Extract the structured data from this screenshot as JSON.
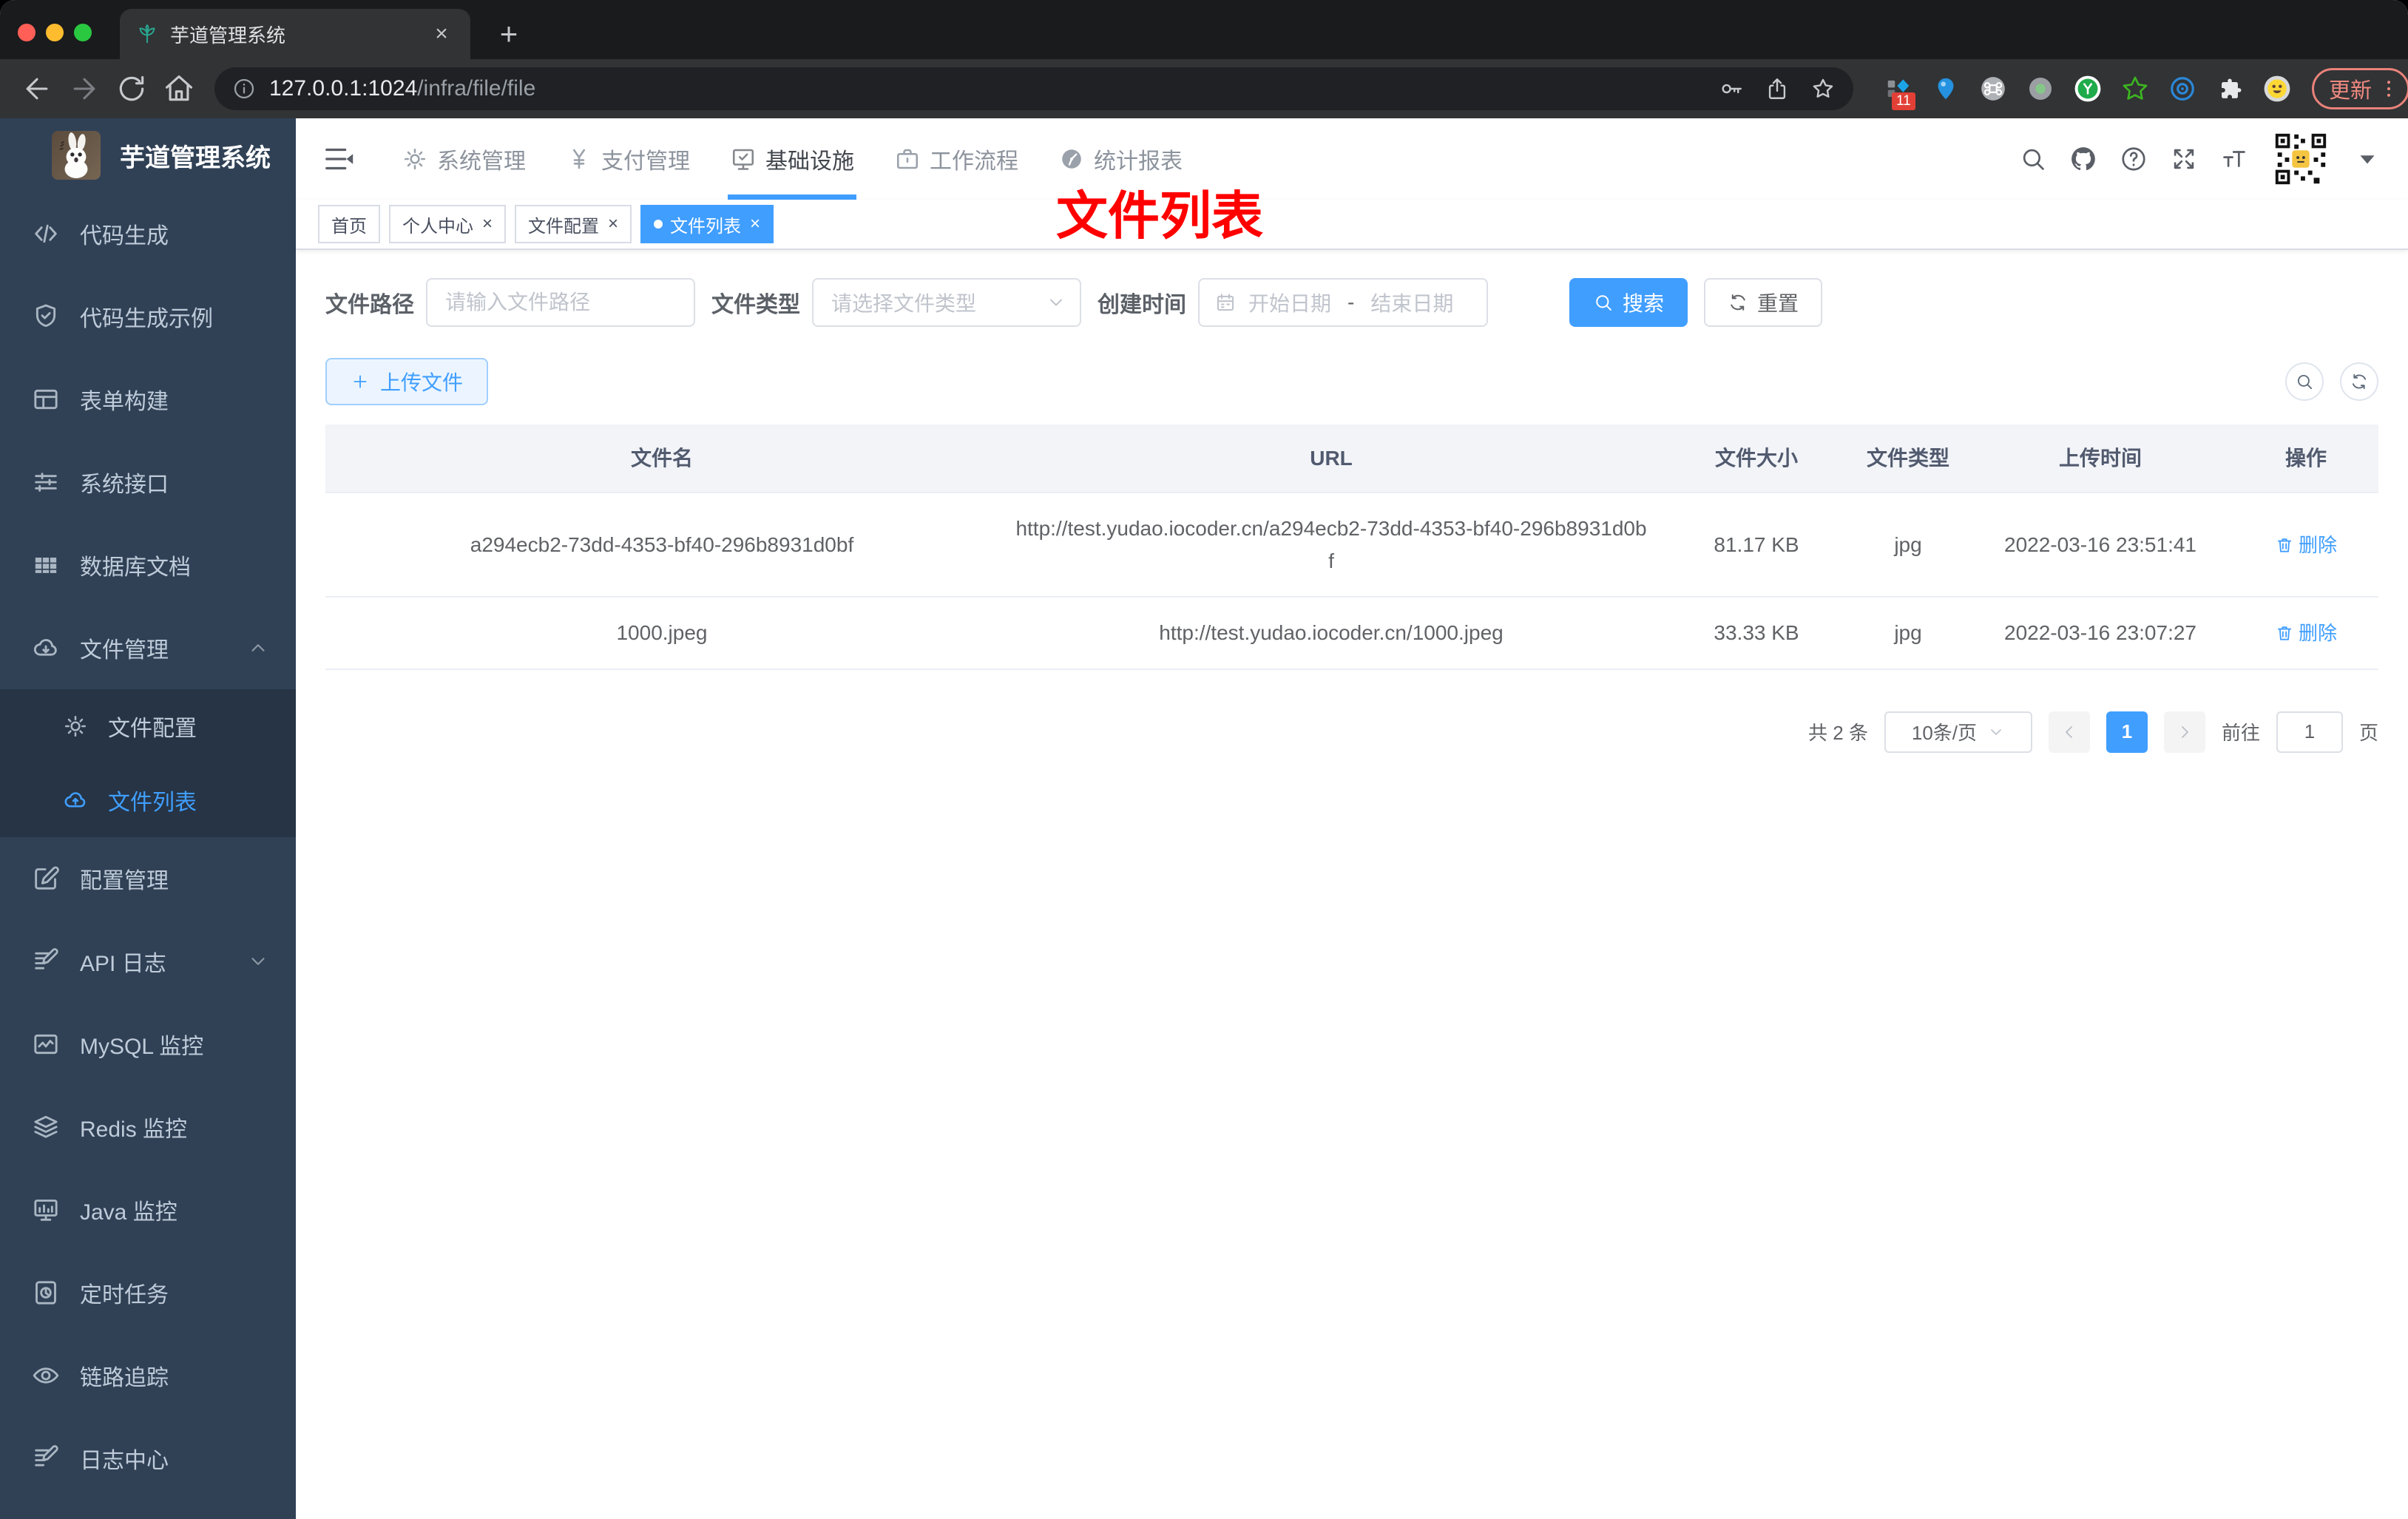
{
  "browser": {
    "tab_title": "芋道管理系统",
    "url_host": "127.0.0.1:1024",
    "url_path": "/infra/file/file",
    "extension_badge": "11",
    "update_label": "更新"
  },
  "glyphs": {
    "plus": "+",
    "close": "×"
  },
  "sidebar": {
    "title": "芋道管理系统",
    "items": [
      {
        "label": "代码生成"
      },
      {
        "label": "代码生成示例"
      },
      {
        "label": "表单构建"
      },
      {
        "label": "系统接口"
      },
      {
        "label": "数据库文档"
      },
      {
        "label": "文件管理"
      },
      {
        "label": "配置管理"
      },
      {
        "label": "API 日志"
      },
      {
        "label": "MySQL 监控"
      },
      {
        "label": "Redis 监控"
      },
      {
        "label": "Java 监控"
      },
      {
        "label": "定时任务"
      },
      {
        "label": "链路追踪"
      },
      {
        "label": "日志中心"
      }
    ],
    "submenu": [
      {
        "label": "文件配置"
      },
      {
        "label": "文件列表"
      }
    ]
  },
  "topnav": {
    "items": [
      {
        "label": "系统管理"
      },
      {
        "label": "支付管理"
      },
      {
        "label": "基础设施"
      },
      {
        "label": "工作流程"
      },
      {
        "label": "统计报表"
      }
    ]
  },
  "tags": [
    {
      "label": "首页"
    },
    {
      "label": "个人中心"
    },
    {
      "label": "文件配置"
    },
    {
      "label": "文件列表"
    }
  ],
  "annotation": {
    "text": "文件列表",
    "color": "#ff0000"
  },
  "filters": {
    "path_label": "文件路径",
    "path_placeholder": "请输入文件路径",
    "type_label": "文件类型",
    "type_placeholder": "请选择文件类型",
    "time_label": "创建时间",
    "start_placeholder": "开始日期",
    "range_separator": "-",
    "end_placeholder": "结束日期",
    "search_label": "搜索",
    "reset_label": "重置"
  },
  "toolbar": {
    "upload_label": "上传文件"
  },
  "table": {
    "columns": [
      "文件名",
      "URL",
      "文件大小",
      "文件类型",
      "上传时间",
      "操作"
    ],
    "rows": [
      {
        "name": "a294ecb2-73dd-4353-bf40-296b8931d0bf",
        "url": "http://test.yudao.iocoder.cn/a294ecb2-73dd-4353-bf40-296b8931d0bf",
        "size": "81.17 KB",
        "type": "jpg",
        "time": "2022-03-16 23:51:41",
        "action": "删除"
      },
      {
        "name": "1000.jpeg",
        "url": "http://test.yudao.iocoder.cn/1000.jpeg",
        "size": "33.33 KB",
        "type": "jpg",
        "time": "2022-03-16 23:07:27",
        "action": "删除"
      }
    ]
  },
  "pagination": {
    "total": "共 2 条",
    "page_size": "10条/页",
    "current_page": "1",
    "goto_label": "前往",
    "goto_value": "1",
    "unit_label": "页"
  },
  "colors": {
    "primary": "#409eff",
    "annotation_red": "#ff0000",
    "sidebar_bg": "#304156",
    "sidebar_submenu_bg": "#263445"
  }
}
